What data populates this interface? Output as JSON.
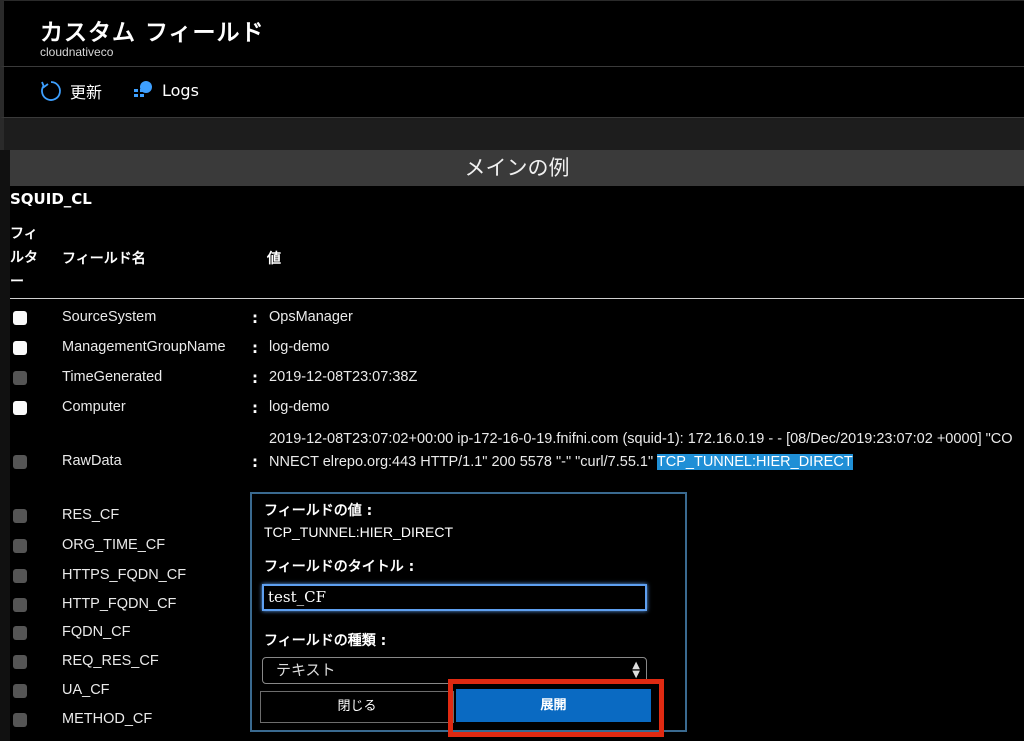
{
  "page": {
    "title": "カスタム フィールド",
    "subtitle": "cloudnativeco"
  },
  "toolbar": {
    "refresh_label": "更新",
    "logs_label": "Logs"
  },
  "main": {
    "header": "メインの例",
    "table_name": "SQUID_CL",
    "columns": {
      "filter": "フィルター",
      "field_name": "フィールド名",
      "value": "値"
    },
    "colon": ":",
    "rows": [
      {
        "name": "SourceSystem",
        "value": "OpsManager",
        "checkbox": "white"
      },
      {
        "name": "ManagementGroupName",
        "value": "log-demo",
        "checkbox": "white"
      },
      {
        "name": "TimeGenerated",
        "value": "2019-12-08T23:07:38Z",
        "checkbox": "gray"
      },
      {
        "name": "Computer",
        "value": "log-demo",
        "checkbox": "white"
      },
      {
        "name": "RawData",
        "value": "2019-12-08T23:07:02+00:00 ip-172-16-0-19.fnifni.com (squid-1): 172.16.0.19 - - [08/Dec/2019:23:07:02 +0000] \"CONNECT elrepo.org:443 HTTP/1.1\" 200 5578 \"-\" \"curl/7.55.1\" ",
        "highlight": "TCP_TUNNEL:HIER_DIRECT",
        "checkbox": "gray"
      },
      {
        "name": "RES_CF",
        "value": "",
        "checkbox": "gray"
      },
      {
        "name": "ORG_TIME_CF",
        "value": "",
        "checkbox": "gray"
      },
      {
        "name": "HTTPS_FQDN_CF",
        "value": "",
        "checkbox": "gray"
      },
      {
        "name": "HTTP_FQDN_CF",
        "value": "",
        "checkbox": "gray"
      },
      {
        "name": "FQDN_CF",
        "value": "",
        "checkbox": "gray"
      },
      {
        "name": "REQ_RES_CF",
        "value": "",
        "checkbox": "gray"
      },
      {
        "name": "UA_CF",
        "value": "",
        "checkbox": "gray"
      },
      {
        "name": "METHOD_CF",
        "value": "",
        "checkbox": "gray"
      }
    ]
  },
  "popup": {
    "value_label": "フィールドの値 :",
    "value": "TCP_TUNNEL:HIER_DIRECT",
    "title_label": "フィールドのタイトル :",
    "title_input": "test_CF",
    "type_label": "フィールドの種類 :",
    "type_selected": "テキスト",
    "close_label": "閉じる",
    "expand_label": "展開"
  },
  "colors": {
    "accent_blue": "#0a6ac2",
    "highlight": "#1f8fd6",
    "focus_ring": "#e02a12"
  }
}
